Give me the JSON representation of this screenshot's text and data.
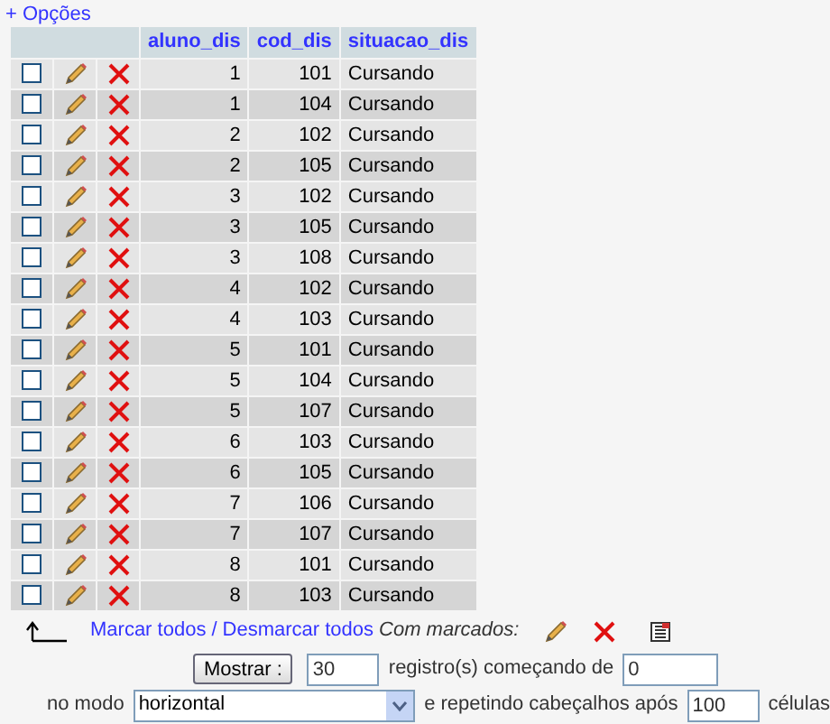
{
  "options_link": "+ Opções",
  "columns": [
    "aluno_dis",
    "cod_dis",
    "situacao_dis"
  ],
  "rows": [
    {
      "checked": false,
      "cells": [
        "1",
        "101",
        "Cursando"
      ]
    },
    {
      "checked": false,
      "cells": [
        "1",
        "104",
        "Cursando"
      ]
    },
    {
      "checked": false,
      "cells": [
        "2",
        "102",
        "Cursando"
      ]
    },
    {
      "checked": false,
      "cells": [
        "2",
        "105",
        "Cursando"
      ]
    },
    {
      "checked": false,
      "cells": [
        "3",
        "102",
        "Cursando"
      ]
    },
    {
      "checked": false,
      "cells": [
        "3",
        "105",
        "Cursando"
      ]
    },
    {
      "checked": false,
      "cells": [
        "3",
        "108",
        "Cursando"
      ]
    },
    {
      "checked": false,
      "cells": [
        "4",
        "102",
        "Cursando"
      ]
    },
    {
      "checked": false,
      "cells": [
        "4",
        "103",
        "Cursando"
      ]
    },
    {
      "checked": false,
      "cells": [
        "5",
        "101",
        "Cursando"
      ]
    },
    {
      "checked": false,
      "cells": [
        "5",
        "104",
        "Cursando"
      ]
    },
    {
      "checked": false,
      "cells": [
        "5",
        "107",
        "Cursando"
      ]
    },
    {
      "checked": false,
      "cells": [
        "6",
        "103",
        "Cursando"
      ]
    },
    {
      "checked": false,
      "cells": [
        "6",
        "105",
        "Cursando"
      ]
    },
    {
      "checked": false,
      "cells": [
        "7",
        "106",
        "Cursando"
      ]
    },
    {
      "checked": false,
      "cells": [
        "7",
        "107",
        "Cursando"
      ]
    },
    {
      "checked": false,
      "cells": [
        "8",
        "101",
        "Cursando"
      ]
    },
    {
      "checked": false,
      "cells": [
        "8",
        "103",
        "Cursando"
      ]
    }
  ],
  "bulk": {
    "check_all": "Marcar todos",
    "separator": "/",
    "uncheck_all": "Desmarcar todos",
    "with_selected": "Com marcados:"
  },
  "paging": {
    "button": "Mostrar :",
    "count": "30",
    "label_start": "registro(s) começando de",
    "start": "0",
    "mode_label": "no modo",
    "mode": "horizontal",
    "repeat_label": "e repetindo cabeçalhos após",
    "repeat": "100",
    "cells_label": "células"
  }
}
